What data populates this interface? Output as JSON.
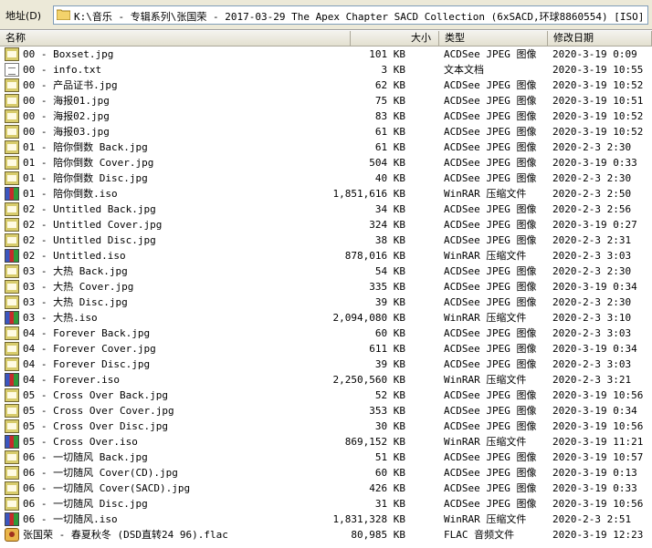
{
  "address": {
    "label": "地址(D)",
    "path": "K:\\音乐 - 专辑系列\\张国荣 - 2017-03-29 The Apex Chapter SACD Collection (6xSACD,环球8860554) [ISO]"
  },
  "columns": {
    "name": "名称",
    "size": "大小",
    "type": "类型",
    "date": "修改日期"
  },
  "files": [
    {
      "name": "00 - Boxset.jpg",
      "size": "101 KB",
      "type": "ACDSee JPEG 图像",
      "date": "2020-3-19 0:09",
      "icon": "jpg"
    },
    {
      "name": "00 - info.txt",
      "size": "3 KB",
      "type": "文本文档",
      "date": "2020-3-19 10:55",
      "icon": "txt"
    },
    {
      "name": "00 - 产品证书.jpg",
      "size": "62 KB",
      "type": "ACDSee JPEG 图像",
      "date": "2020-3-19 10:52",
      "icon": "jpg"
    },
    {
      "name": "00 - 海报01.jpg",
      "size": "75 KB",
      "type": "ACDSee JPEG 图像",
      "date": "2020-3-19 10:51",
      "icon": "jpg"
    },
    {
      "name": "00 - 海报02.jpg",
      "size": "83 KB",
      "type": "ACDSee JPEG 图像",
      "date": "2020-3-19 10:52",
      "icon": "jpg"
    },
    {
      "name": "00 - 海报03.jpg",
      "size": "61 KB",
      "type": "ACDSee JPEG 图像",
      "date": "2020-3-19 10:52",
      "icon": "jpg"
    },
    {
      "name": "01 - 陪你倒数 Back.jpg",
      "size": "61 KB",
      "type": "ACDSee JPEG 图像",
      "date": "2020-2-3 2:30",
      "icon": "jpg"
    },
    {
      "name": "01 - 陪你倒数 Cover.jpg",
      "size": "504 KB",
      "type": "ACDSee JPEG 图像",
      "date": "2020-3-19 0:33",
      "icon": "jpg"
    },
    {
      "name": "01 - 陪你倒数 Disc.jpg",
      "size": "40 KB",
      "type": "ACDSee JPEG 图像",
      "date": "2020-2-3 2:30",
      "icon": "jpg"
    },
    {
      "name": "01 - 陪你倒数.iso",
      "size": "1,851,616 KB",
      "type": "WinRAR 压缩文件",
      "date": "2020-2-3 2:50",
      "icon": "iso"
    },
    {
      "name": "02 - Untitled Back.jpg",
      "size": "34 KB",
      "type": "ACDSee JPEG 图像",
      "date": "2020-2-3 2:56",
      "icon": "jpg"
    },
    {
      "name": "02 - Untitled Cover.jpg",
      "size": "324 KB",
      "type": "ACDSee JPEG 图像",
      "date": "2020-3-19 0:27",
      "icon": "jpg"
    },
    {
      "name": "02 - Untitled Disc.jpg",
      "size": "38 KB",
      "type": "ACDSee JPEG 图像",
      "date": "2020-2-3 2:31",
      "icon": "jpg"
    },
    {
      "name": "02 - Untitled.iso",
      "size": "878,016 KB",
      "type": "WinRAR 压缩文件",
      "date": "2020-2-3 3:03",
      "icon": "iso"
    },
    {
      "name": "03 - 大热 Back.jpg",
      "size": "54 KB",
      "type": "ACDSee JPEG 图像",
      "date": "2020-2-3 2:30",
      "icon": "jpg"
    },
    {
      "name": "03 - 大热 Cover.jpg",
      "size": "335 KB",
      "type": "ACDSee JPEG 图像",
      "date": "2020-3-19 0:34",
      "icon": "jpg"
    },
    {
      "name": "03 - 大热 Disc.jpg",
      "size": "39 KB",
      "type": "ACDSee JPEG 图像",
      "date": "2020-2-3 2:30",
      "icon": "jpg"
    },
    {
      "name": "03 - 大热.iso",
      "size": "2,094,080 KB",
      "type": "WinRAR 压缩文件",
      "date": "2020-2-3 3:10",
      "icon": "iso"
    },
    {
      "name": "04 - Forever Back.jpg",
      "size": "60 KB",
      "type": "ACDSee JPEG 图像",
      "date": "2020-2-3 3:03",
      "icon": "jpg"
    },
    {
      "name": "04 - Forever Cover.jpg",
      "size": "611 KB",
      "type": "ACDSee JPEG 图像",
      "date": "2020-3-19 0:34",
      "icon": "jpg"
    },
    {
      "name": "04 - Forever Disc.jpg",
      "size": "39 KB",
      "type": "ACDSee JPEG 图像",
      "date": "2020-2-3 3:03",
      "icon": "jpg"
    },
    {
      "name": "04 - Forever.iso",
      "size": "2,250,560 KB",
      "type": "WinRAR 压缩文件",
      "date": "2020-2-3 3:21",
      "icon": "iso"
    },
    {
      "name": "05 - Cross Over Back.jpg",
      "size": "52 KB",
      "type": "ACDSee JPEG 图像",
      "date": "2020-3-19 10:56",
      "icon": "jpg"
    },
    {
      "name": "05 - Cross Over Cover.jpg",
      "size": "353 KB",
      "type": "ACDSee JPEG 图像",
      "date": "2020-3-19 0:34",
      "icon": "jpg"
    },
    {
      "name": "05 - Cross Over Disc.jpg",
      "size": "30 KB",
      "type": "ACDSee JPEG 图像",
      "date": "2020-3-19 10:56",
      "icon": "jpg"
    },
    {
      "name": "05 - Cross Over.iso",
      "size": "869,152 KB",
      "type": "WinRAR 压缩文件",
      "date": "2020-3-19 11:21",
      "icon": "iso"
    },
    {
      "name": "06 - 一切随风 Back.jpg",
      "size": "51 KB",
      "type": "ACDSee JPEG 图像",
      "date": "2020-3-19 10:57",
      "icon": "jpg"
    },
    {
      "name": "06 - 一切随风 Cover(CD).jpg",
      "size": "60 KB",
      "type": "ACDSee JPEG 图像",
      "date": "2020-3-19 0:13",
      "icon": "jpg"
    },
    {
      "name": "06 - 一切随风 Cover(SACD).jpg",
      "size": "426 KB",
      "type": "ACDSee JPEG 图像",
      "date": "2020-3-19 0:33",
      "icon": "jpg"
    },
    {
      "name": "06 - 一切随风 Disc.jpg",
      "size": "31 KB",
      "type": "ACDSee JPEG 图像",
      "date": "2020-3-19 10:56",
      "icon": "jpg"
    },
    {
      "name": "06 - 一切随风.iso",
      "size": "1,831,328 KB",
      "type": "WinRAR 压缩文件",
      "date": "2020-2-3 2:51",
      "icon": "iso"
    },
    {
      "name": "张国荣 - 春夏秋冬 (DSD直转24 96).flac",
      "size": "80,985 KB",
      "type": "FLAC 音频文件",
      "date": "2020-3-19 12:23",
      "icon": "flac"
    }
  ]
}
